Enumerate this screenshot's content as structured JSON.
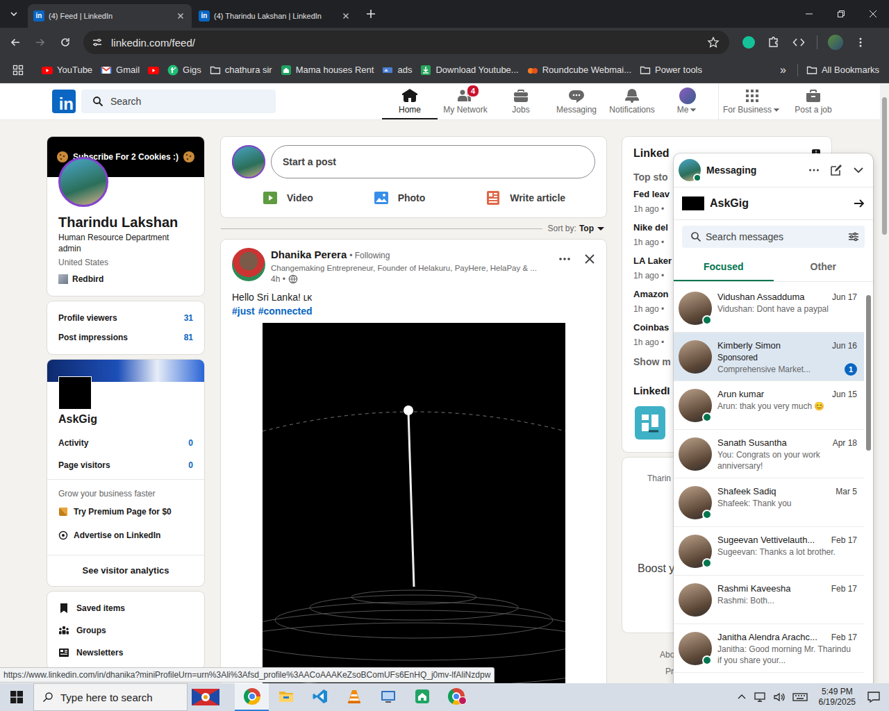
{
  "browser": {
    "tabs": [
      {
        "label": "(4) Feed | LinkedIn",
        "selected": true
      },
      {
        "label": "(4) Tharindu Lakshan | LinkedIn",
        "selected": false
      }
    ],
    "url": "linkedin.com/feed/",
    "bookmarks": [
      {
        "label": "YouTube",
        "kind": "youtube"
      },
      {
        "label": "Gmail",
        "kind": "gmail"
      },
      {
        "kind": "youtube"
      },
      {
        "label": "Gigs",
        "kind": "fiverr"
      },
      {
        "label": "chathura sir",
        "kind": "folder"
      },
      {
        "label": "Mama houses Rent",
        "kind": "house"
      },
      {
        "label": "ads",
        "kind": "ads"
      },
      {
        "label": "Download Youtube...",
        "kind": "download"
      },
      {
        "label": "Roundcube Webmai...",
        "kind": "roundcube"
      },
      {
        "label": "Power tools",
        "kind": "folder"
      }
    ],
    "overflow": "»",
    "all_bookmarks": "All Bookmarks",
    "status_url": "https://www.linkedin.com/in/dhanika?miniProfileUrn=urn%3Ali%3Afsd_profile%3AACoAAAKeZsoBComUFs6EnHQ_j0mv-lfAliNzdpw"
  },
  "linkedin": {
    "logo": "in",
    "search": {
      "placeholder": "Search"
    },
    "nav": [
      {
        "label": "Home",
        "kind": "home",
        "selected": true,
        "dropdown": false
      },
      {
        "label": "My Network",
        "kind": "network",
        "selected": false,
        "dropdown": false,
        "badge": "4"
      },
      {
        "label": "Jobs",
        "kind": "jobs",
        "selected": false,
        "dropdown": false
      },
      {
        "label": "Messaging",
        "kind": "messaging",
        "selected": false,
        "dropdown": false
      },
      {
        "label": "Notifications",
        "kind": "bell",
        "selected": false,
        "dropdown": false
      },
      {
        "label": "Me",
        "kind": "avatar",
        "selected": false,
        "dropdown": true
      }
    ],
    "business_nav": [
      {
        "label": "For Business",
        "kind": "grid",
        "selected": false,
        "dropdown": true
      },
      {
        "label": "Post a job",
        "kind": "postjob",
        "selected": false,
        "dropdown": false
      }
    ],
    "profile": {
      "banner": "Subscribe For 2 Cookies :)",
      "name": "Tharindu Lakshan",
      "headline": "Human Resource Department admin",
      "location": "United States",
      "company": "Redbird"
    },
    "stats": [
      {
        "label": "Profile viewers",
        "value": "31"
      },
      {
        "label": "Post impressions",
        "value": "81"
      }
    ],
    "page": {
      "name": "AskGig",
      "stats": [
        {
          "label": "Activity",
          "value": "0"
        },
        {
          "label": "Page visitors",
          "value": "0"
        }
      ],
      "promo_title": "Grow your business faster",
      "promos": [
        {
          "label": "Try Premium Page for $0",
          "kind": "premium"
        },
        {
          "label": "Advertise on LinkedIn",
          "kind": "advertise"
        }
      ],
      "analytics": "See visitor analytics"
    },
    "shortcuts": [
      {
        "label": "Saved items",
        "kind": "bookmark"
      },
      {
        "label": "Groups",
        "kind": "groups"
      },
      {
        "label": "Newsletters",
        "kind": "newsletter"
      }
    ],
    "composer": {
      "placeholder": "Start a post",
      "actions": [
        {
          "label": "Video",
          "kind": "video",
          "color": "#5f9b41"
        },
        {
          "label": "Photo",
          "kind": "photo",
          "color": "#378fe9"
        },
        {
          "label": "Write article",
          "kind": "article",
          "color": "#e06847"
        }
      ]
    },
    "sort": {
      "label": "Sort by:",
      "value": "Top"
    },
    "post": {
      "author": "Dhanika Perera",
      "relation": "• Following",
      "headline": "Changemaking Entrepreneur, Founder of Helakuru, PayHere, HelaPay & ...",
      "time": "4h •",
      "text": "Hello Sri Lanka! ʟᴋ",
      "hashtags": [
        "#just",
        "#connected"
      ]
    },
    "news": {
      "title": "Linked",
      "subtitle": "Top sto",
      "items": [
        {
          "title": "Fed leav",
          "meta": "1h ago •"
        },
        {
          "title": "Nike del",
          "meta": "1h ago •"
        },
        {
          "title": "LA Laker",
          "meta": "1h ago •"
        },
        {
          "title": "Amazon",
          "meta": "1h ago •"
        },
        {
          "title": "Coinbas",
          "meta": "1h ago •"
        }
      ],
      "more": "Show m",
      "games_title": "LinkedI"
    },
    "promo_card": {
      "caption": "Tharin",
      "title": "Boost y"
    },
    "footer": [
      "Abo",
      "Pr"
    ]
  },
  "messaging": {
    "title": "Messaging",
    "page": "AskGig",
    "search": {
      "placeholder": "Search messages"
    },
    "tabs": [
      {
        "label": "Focused",
        "selected": true
      },
      {
        "label": "Other",
        "selected": false
      }
    ],
    "conversations": [
      {
        "name": "Vidushan Assadduma",
        "date": "Jun 17",
        "preview": "Vidushan: Dont have a paypal",
        "online": true,
        "selected": false
      },
      {
        "name": "Kimberly Simon",
        "date": "Jun 16",
        "tag": "Sponsored",
        "preview": "Comprehensive Market...",
        "badge": "1",
        "online": false,
        "selected": true
      },
      {
        "name": "Arun kumar",
        "date": "Jun 15",
        "preview": "Arun: thak you very much 😊",
        "online": true,
        "selected": false
      },
      {
        "name": "Sanath Susantha",
        "date": "Apr 18",
        "preview": "You: Congrats on your work anniversary!",
        "online": false,
        "selected": false
      },
      {
        "name": "Shafeek Sadiq",
        "date": "Mar 5",
        "preview": "Shafeek: Thank you",
        "online": true,
        "selected": false
      },
      {
        "name": "Sugeevan Vettivelauth...",
        "date": "Feb 17",
        "preview": "Sugeevan: Thanks a lot brother.",
        "online": true,
        "selected": false
      },
      {
        "name": "Rashmi Kaveesha",
        "date": "Feb 17",
        "preview": "Rashmi: Both...",
        "online": false,
        "selected": false
      },
      {
        "name": "Janitha Alendra Arachc...",
        "date": "Feb 17",
        "preview": "Janitha: Good morning Mr. Tharindu if you share your...",
        "online": true,
        "selected": false
      }
    ]
  },
  "taskbar": {
    "search": "Type here to search",
    "time": "5:49 PM",
    "date": "6/19/2025",
    "apps": [
      {
        "kind": "chrome",
        "active": true
      },
      {
        "kind": "explorer",
        "active": false
      },
      {
        "kind": "vscode",
        "active": false
      },
      {
        "kind": "vlc",
        "active": false
      },
      {
        "kind": "remote",
        "active": false
      },
      {
        "kind": "house",
        "active": false
      },
      {
        "kind": "chrome-profile",
        "active": false
      }
    ]
  }
}
